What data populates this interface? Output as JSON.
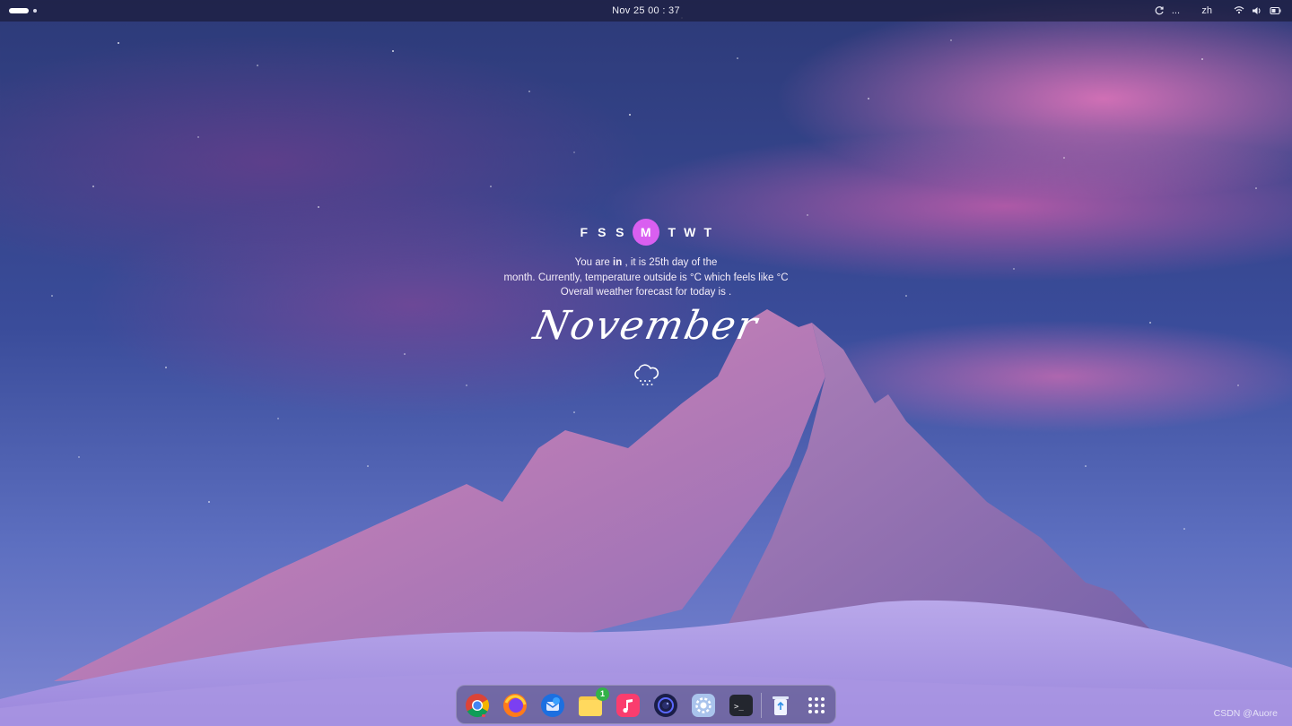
{
  "topbar": {
    "clock": "Nov 25  00 : 37",
    "tray": {
      "refresh_icon": "refresh-icon",
      "more": "...",
      "input_method": "zh",
      "wifi_icon": "wifi-icon",
      "volume_icon": "volume-icon",
      "battery_icon": "battery-icon"
    }
  },
  "widget": {
    "days": [
      "F",
      "S",
      "S",
      "M",
      "T",
      "W",
      "T"
    ],
    "today": "M",
    "line1_a": "You are ",
    "line1_b": "in",
    "line1_c": " , it is 25th day of the",
    "line2": "month. Currently, temperature outside is °C which feels like °C",
    "line3": "Overall weather forecast for today is .",
    "month": "November",
    "weather_icon": "snow-cloud-icon"
  },
  "dock": {
    "items": [
      {
        "name": "chrome",
        "icon": "chrome-icon"
      },
      {
        "name": "firefox",
        "icon": "firefox-icon"
      },
      {
        "name": "thunderbird",
        "icon": "thunderbird-icon"
      },
      {
        "name": "files",
        "icon": "folder-icon",
        "badge": "1"
      },
      {
        "name": "music",
        "icon": "music-icon"
      },
      {
        "name": "camera",
        "icon": "camera-icon"
      },
      {
        "name": "settings",
        "icon": "settings-icon"
      },
      {
        "name": "terminal",
        "icon": "terminal-icon",
        "label": ">_"
      },
      {
        "name": "trash",
        "icon": "trash-icon"
      },
      {
        "name": "app-grid",
        "icon": "grid-icon"
      }
    ]
  },
  "watermark": "CSDN @Auore"
}
